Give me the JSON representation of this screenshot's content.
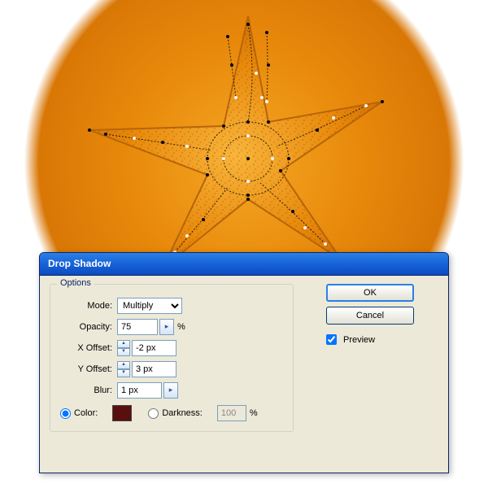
{
  "dialog": {
    "title": "Drop Shadow",
    "options_legend": "Options",
    "mode_label": "Mode:",
    "mode_value": "Multiply",
    "opacity_label": "Opacity:",
    "opacity_value": "75",
    "opacity_unit": "%",
    "xoff_label": "X Offset:",
    "xoff_value": "-2 px",
    "yoff_label": "Y Offset:",
    "yoff_value": "3 px",
    "blur_label": "Blur:",
    "blur_value": "1 px",
    "color_label": "Color:",
    "darkness_label": "Darkness:",
    "darkness_value": "100",
    "darkness_unit": "%",
    "color_swatch": "#5a0f0f"
  },
  "buttons": {
    "ok": "OK",
    "cancel": "Cancel",
    "preview": "Preview"
  }
}
